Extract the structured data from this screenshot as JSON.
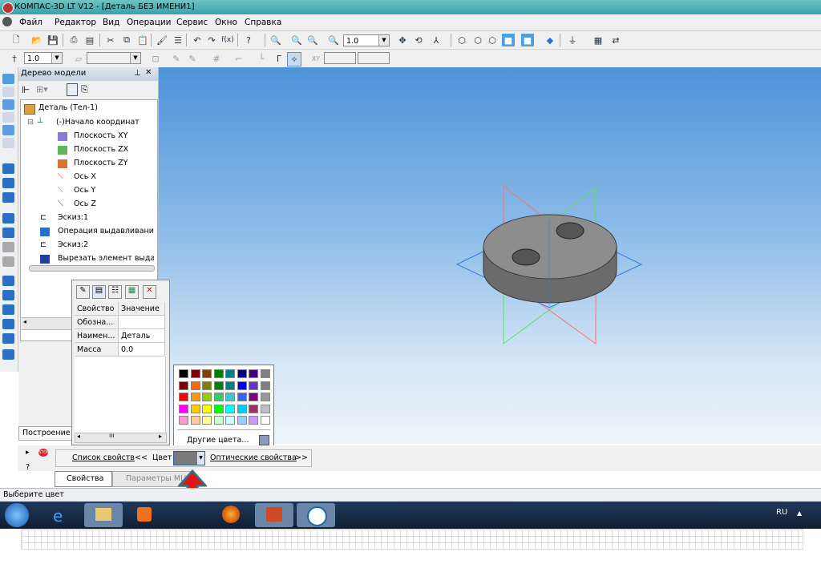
{
  "window": {
    "title": "КОМПАС-3D LT V12 - [Деталь БЕЗ ИМЕНИ1]"
  },
  "menu": [
    "Файл",
    "Редактор",
    "Вид",
    "Операции",
    "Сервис",
    "Окно",
    "Справка"
  ],
  "toolbar": {
    "zoom_value": "1.0",
    "line_value": "1.0"
  },
  "tree": {
    "title": "Дерево модели",
    "items": [
      "Деталь (Тел-1)",
      "(-)Начало координат",
      "Плоскость XY",
      "Плоскость ZX",
      "Плоскость ZY",
      "Ось X",
      "Ось Y",
      "Ось Z",
      "Эскиз:1",
      "Операция выдавливания",
      "Эскиз:2",
      "Вырезать элемент выда"
    ],
    "tab_build": "Построение"
  },
  "properties": {
    "headers": [
      "Свойство",
      "Значение"
    ],
    "rows": [
      [
        "Обозна...",
        ""
      ],
      [
        "Наимен...",
        "Деталь"
      ],
      [
        "Масса",
        "0.0"
      ]
    ]
  },
  "palette": {
    "other_colors": "Другие цвета...",
    "colors": [
      [
        "#000000",
        "#800000",
        "#804000",
        "#008000",
        "#008080",
        "#000080",
        "#400080",
        "#808080"
      ],
      [
        "#800000",
        "#ff6600",
        "#808000",
        "#008000",
        "#008080",
        "#0000ff",
        "#6633cc",
        "#808080"
      ],
      [
        "#ff0000",
        "#ff9900",
        "#99cc00",
        "#33cc66",
        "#33cccc",
        "#3366ff",
        "#800080",
        "#999999"
      ],
      [
        "#ff00ff",
        "#ffcc00",
        "#ffff00",
        "#00ff00",
        "#00ffff",
        "#00ccff",
        "#993366",
        "#c0c0c0"
      ],
      [
        "#ff99cc",
        "#ffcc99",
        "#ffff99",
        "#ccffcc",
        "#ccffff",
        "#99ccff",
        "#cc99ff",
        "#ffffff"
      ]
    ]
  },
  "propbar": {
    "list_label": "Список свойств",
    "list_arrows": "<<",
    "color_label": "Цвет",
    "color_value": "#8a8a8a",
    "optical_label": "Оптические свойства",
    "optical_arrows": ">>",
    "tab_properties": "Свойства",
    "tab_params": "Параметры МЦ"
  },
  "status": {
    "text": "Выберите цвет"
  },
  "taskbar": {
    "lang": "RU"
  },
  "colors": {
    "arrow": "#e81010",
    "arrow_outline": "#3d6b80"
  }
}
